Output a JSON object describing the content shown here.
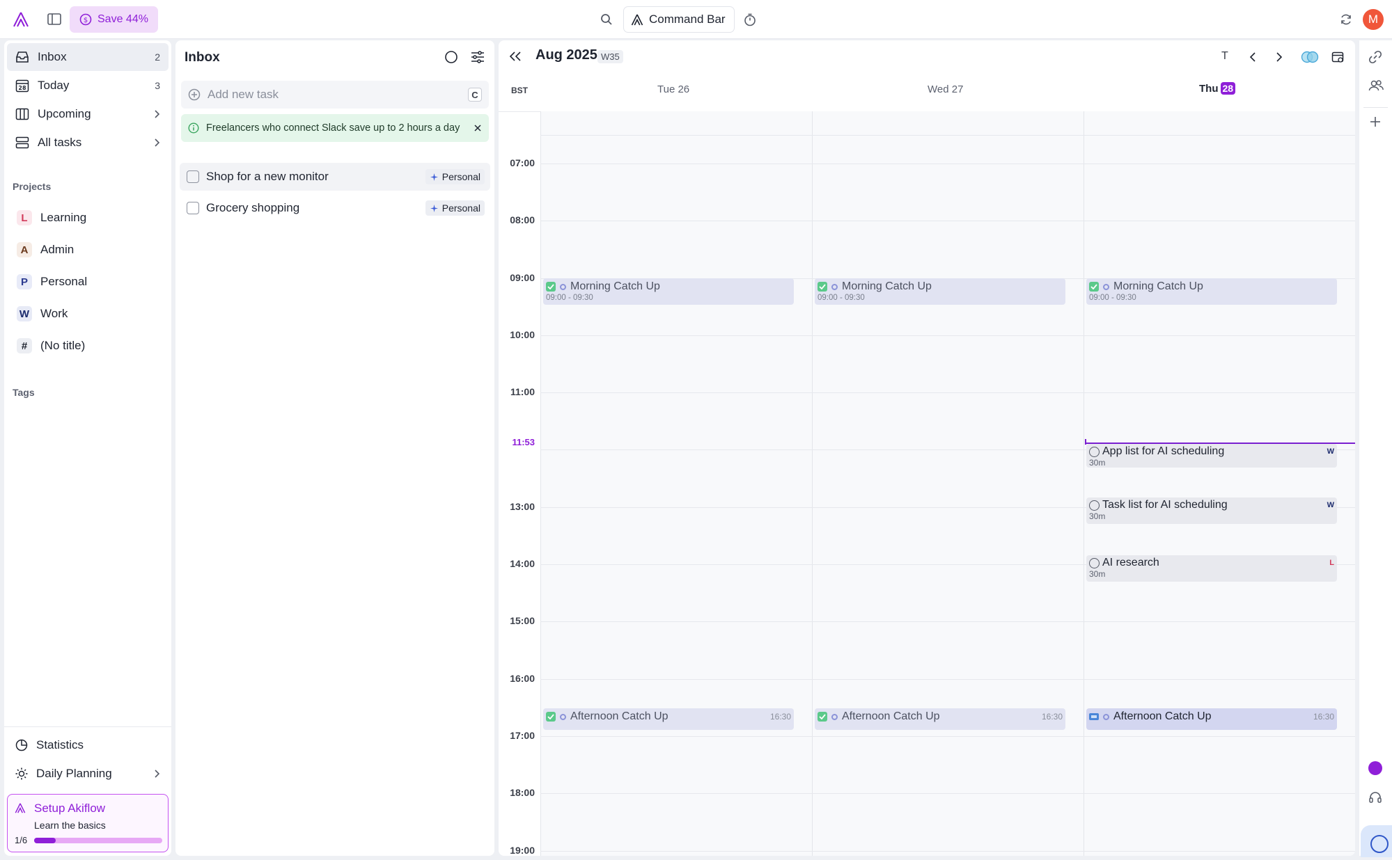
{
  "topbar": {
    "save_label": "Save 44%",
    "command_bar_label": "Command Bar",
    "avatar_initial": "M"
  },
  "sidebar": {
    "nav": [
      {
        "label": "Inbox",
        "count": "2"
      },
      {
        "label": "Today",
        "count": "3"
      },
      {
        "label": "Upcoming"
      },
      {
        "label": "All tasks"
      }
    ],
    "today_icon_day": "28",
    "projects_label": "Projects",
    "projects": [
      {
        "letter": "L",
        "label": "Learning",
        "color": "#d23a5a",
        "bg": "#fbe7ec"
      },
      {
        "letter": "A",
        "label": "Admin",
        "color": "#6b3a1e",
        "bg": "#f6ece5"
      },
      {
        "letter": "P",
        "label": "Personal",
        "color": "#2b3a8f",
        "bg": "#e8ebf8"
      },
      {
        "letter": "W",
        "label": "Work",
        "color": "#1d2c6e",
        "bg": "#e7eaf6"
      },
      {
        "letter": "#",
        "label": "(No title)",
        "color": "#1f2430",
        "bg": "#eceef3"
      }
    ],
    "tags_label": "Tags",
    "bottom": [
      {
        "label": "Statistics"
      },
      {
        "label": "Daily Planning"
      }
    ],
    "setup": {
      "title": "Setup Akiflow",
      "subtitle": "Learn the basics",
      "progress_text": "1/6",
      "progress": 0.17
    }
  },
  "inbox": {
    "title": "Inbox",
    "add_placeholder": "Add new task",
    "add_shortcut": "C",
    "banner_text": "Freelancers who connect Slack save up to 2 hours a day",
    "tasks": [
      {
        "label": "Shop for a new monitor",
        "tag": "Personal"
      },
      {
        "label": "Grocery shopping",
        "tag": "Personal"
      }
    ]
  },
  "calendar": {
    "month": "Aug 2025",
    "week": "W35",
    "today_button": "T",
    "timezone": "BST",
    "days": [
      {
        "label": "Tue 26"
      },
      {
        "label": "Wed 27"
      },
      {
        "label": "Thu",
        "date": "28"
      }
    ],
    "hours": [
      "07:00",
      "08:00",
      "09:00",
      "10:00",
      "11:00",
      "13:00",
      "14:00",
      "15:00",
      "16:00",
      "17:00",
      "18:00",
      "19:00"
    ],
    "now_label": "11:53",
    "events": {
      "morning_title": "Morning Catch Up",
      "morning_time": "09:00 - 09:30",
      "afternoon_title": "Afternoon Catch Up",
      "afternoon_time": "16:30"
    },
    "tasks": [
      {
        "label": "App list for AI scheduling",
        "duration": "30m",
        "tag": "W"
      },
      {
        "label": "Task list for AI scheduling",
        "duration": "30m",
        "tag": "W"
      },
      {
        "label": "AI research",
        "duration": "30m",
        "tag": "L"
      }
    ]
  },
  "colors": {
    "accent": "#8f1fd8",
    "now_line": "#7a1fd0"
  }
}
